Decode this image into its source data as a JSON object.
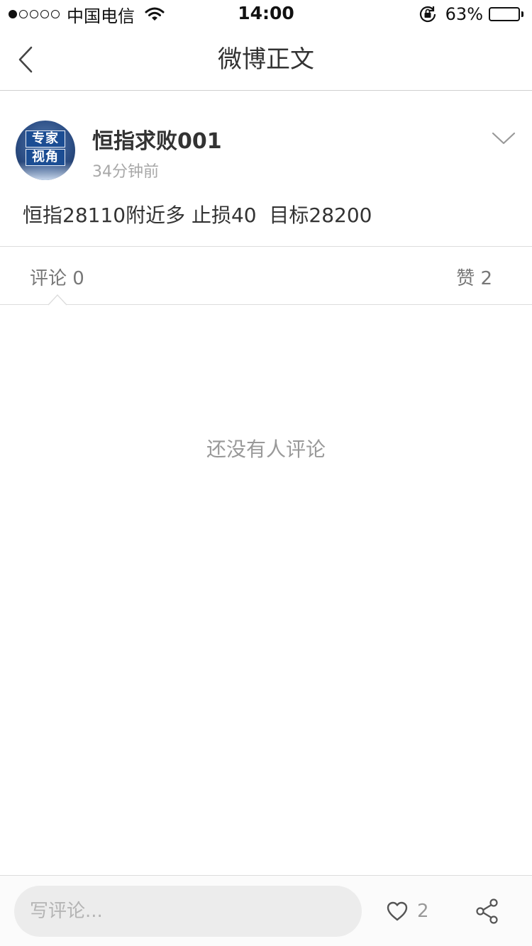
{
  "status_bar": {
    "carrier": "中国电信",
    "time": "14:00",
    "battery": "63%",
    "battery_level": 0.63,
    "signal_bars_filled": 1,
    "signal_bars_total": 5
  },
  "nav": {
    "title": "微博正文",
    "back_icon": "chevron-left-icon"
  },
  "post": {
    "username": "恒指求败001",
    "time": "34分钟前",
    "text": "恒指28110附近多 止损40  目标28200",
    "avatar": {
      "line1": "专家",
      "line2": "视角"
    },
    "more_icon": "chevron-down-icon"
  },
  "tabs": {
    "comments": "评论 0",
    "likes": "赞 2"
  },
  "empty_state": "还没有人评论",
  "bottom_bar": {
    "comment_placeholder": "写评论...",
    "like_count": "2",
    "like_icon": "heart-icon",
    "share_icon": "share-icon"
  },
  "colors": {
    "divider": "#dcdcdc",
    "text_primary": "#333333",
    "text_secondary": "#999999",
    "input_background": "#ececec"
  }
}
